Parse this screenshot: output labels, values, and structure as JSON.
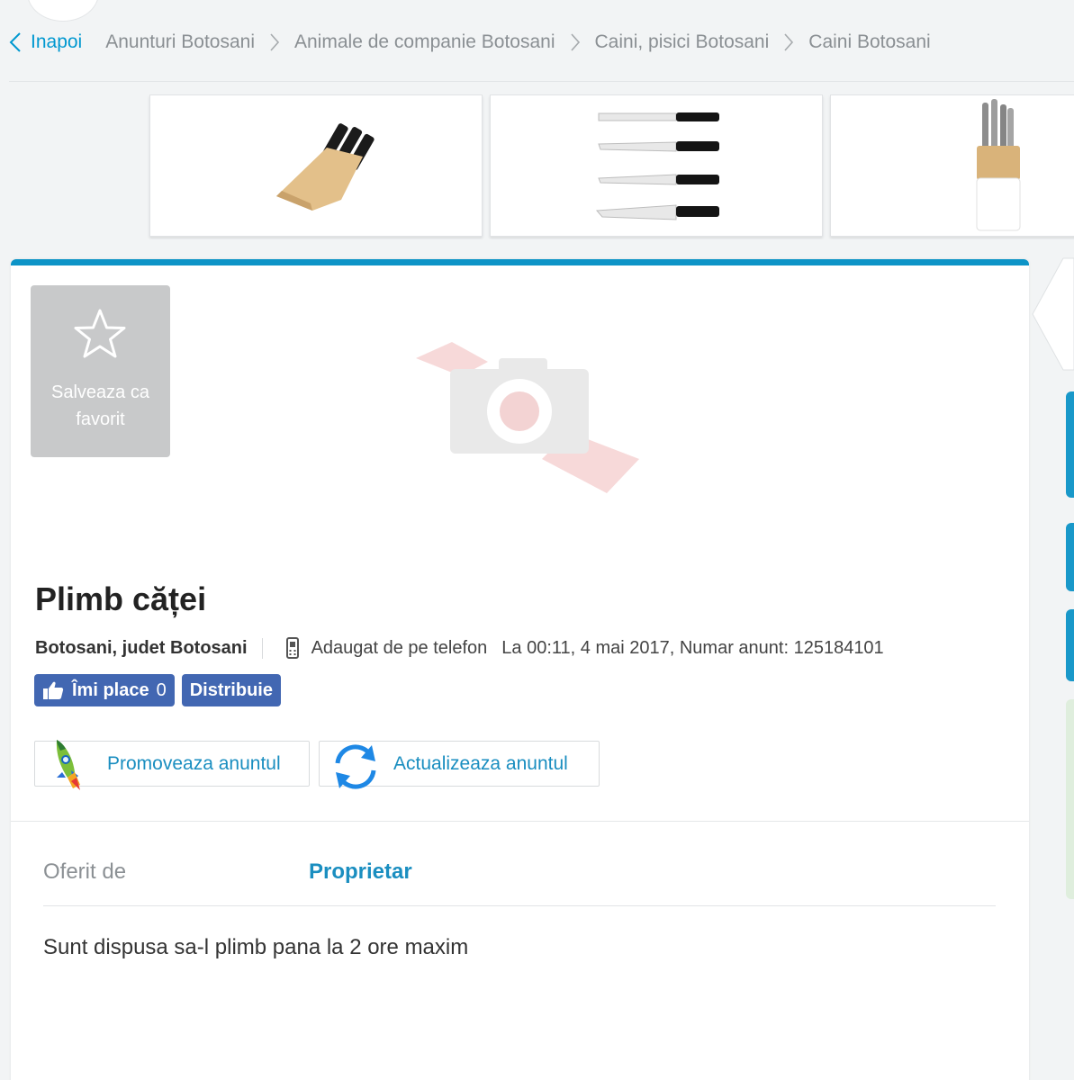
{
  "breadcrumb": {
    "back_label": "Inapoi",
    "items": [
      "Anunturi Botosani",
      "Animale de companie Botosani",
      "Caini, pisici Botosani",
      "Caini Botosani"
    ]
  },
  "ads": [
    {
      "icon": "knife-block-wooden-icon"
    },
    {
      "icon": "knife-set-icon"
    },
    {
      "icon": "knife-block-white-icon"
    }
  ],
  "favorite": {
    "label": "Salveaza ca favorit"
  },
  "listing": {
    "title": "Plimb căței",
    "location": "Botosani, judet Botosani",
    "added_from": "Adaugat de pe telefon",
    "date_line": "La 00:11, 4 mai 2017, Numar anunt: 125184101"
  },
  "social": {
    "like_label": "Îmi place",
    "like_count": "0",
    "share_label": "Distribuie"
  },
  "actions": {
    "promote_label": "Promoveaza anuntul",
    "refresh_label": "Actualizeaza anuntul"
  },
  "details": {
    "offered_by_label": "Oferit de",
    "offered_by_value": "Proprietar"
  },
  "description": "Sunt dispusa sa-l plimb pana la 2 ore maxim",
  "colors": {
    "accent": "#0d94c7",
    "link": "#1a8ec0",
    "facebook": "#4267b2",
    "favorite_bg": "#c8c9ca"
  }
}
